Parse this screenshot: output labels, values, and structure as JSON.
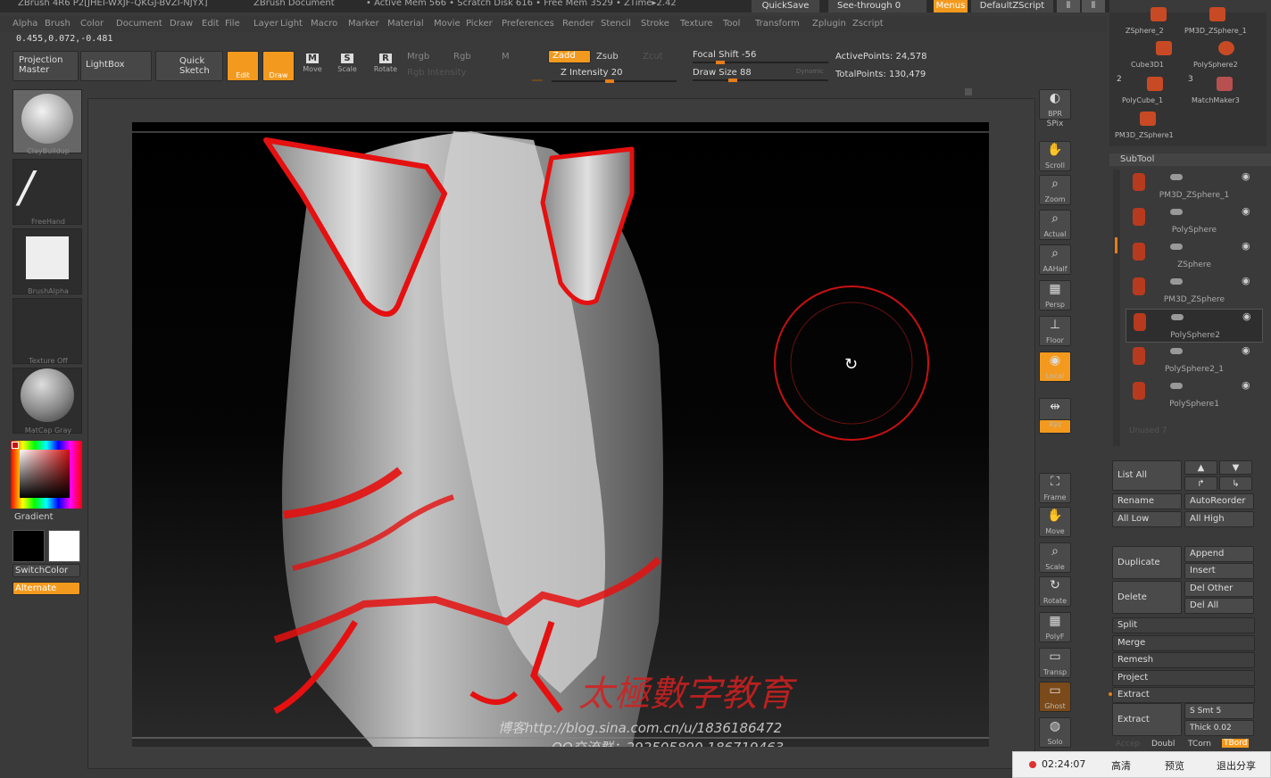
{
  "title": {
    "app": "ZBrush 4R6 P2[JHEI-WXJF-QKGJ-BVZI-NJYX]",
    "doc": "ZBrush Document",
    "stats": "• Active Mem 566 • Scratch Disk 616 • Free Mem 3529 • ZTime▸2.42",
    "quicksave": "QuickSave",
    "seethrough": "See-through   0",
    "menus": "Menus",
    "defaultzscript": "DefaultZScript"
  },
  "menu": [
    "Alpha",
    "Brush",
    "Color",
    "Document",
    "Draw",
    "Edit",
    "File",
    "Layer",
    "Light",
    "Macro",
    "Marker",
    "Material",
    "Movie",
    "Picker",
    "Preferences",
    "Render",
    "Stencil",
    "Stroke",
    "Texture",
    "Tool",
    "Transform",
    "Zplugin",
    "Zscript"
  ],
  "coords": "0.455,0.072,-0.481",
  "toolbar": {
    "projection_master": "Projection Master",
    "lightbox": "LightBox",
    "quick_sketch": "Quick Sketch",
    "edit": "Edit",
    "draw": "Draw",
    "move": "Move",
    "scale": "Scale",
    "rotate": "Rotate",
    "mrgb": "Mrgb",
    "rgb": "Rgb",
    "m": "M",
    "rgb_intensity": "Rgb Intensity",
    "zadd": "Zadd",
    "zsub": "Zsub",
    "zcut": "Zcut",
    "z_intensity": "Z Intensity 20",
    "focal_shift": "Focal Shift -56",
    "draw_size": "Draw Size 88",
    "dynamic": "Dynamic",
    "active_points": "ActivePoints: 24,578",
    "total_points": "TotalPoints: 130,479"
  },
  "left": {
    "brush": "ClayBuildup",
    "stroke": "FreeHand",
    "alpha": "BrushAlpha",
    "texture": "Texture Off",
    "material": "MatCap Gray",
    "gradient": "Gradient",
    "switchcolor": "SwitchColor",
    "alternate": "Alternate"
  },
  "shelf": [
    "BPR",
    "SPix",
    "Scroll",
    "Zoom",
    "Actual",
    "AAHalf",
    "Persp",
    "Floor",
    "Local",
    "L.Sym",
    "Xyz",
    "Frame",
    "Move",
    "Scale",
    "Rotate",
    "PolyF",
    "Transp",
    "Ghost",
    "Solo"
  ],
  "tools": {
    "items": [
      "ZSphere_2",
      "PM3D_ZSphere_1",
      "Cube3D1",
      "PolySphere2",
      "PolyCube_1",
      "MatchMaker3",
      "PM3D_ZSphere1"
    ],
    "count_a": "2",
    "count_b": "3"
  },
  "subtool": {
    "header": "SubTool",
    "rows": [
      "PM3D_ZSphere_1",
      "PolySphere",
      "ZSphere",
      "PM3D_ZSphere",
      "PolySphere2",
      "PolySphere2_1",
      "PolySphere1"
    ],
    "unused": "Unused 7",
    "list_all": "List All",
    "rename": "Rename",
    "autoreorder": "AutoReorder",
    "all_low": "All Low",
    "all_high": "All High",
    "duplicate": "Duplicate",
    "append": "Append",
    "insert": "Insert",
    "delete": "Delete",
    "del_other": "Del Other",
    "del_all": "Del All",
    "split": "Split",
    "merge": "Merge",
    "remesh": "Remesh",
    "project": "Project",
    "extract_header": "Extract",
    "extract": "Extract",
    "s_smt": "S Smt 5",
    "thick": "Thick 0.02",
    "accep": "Accep",
    "double": "Doubl",
    "tcorn": "TCorn",
    "tbord": "TBord"
  },
  "watermark": {
    "cn": "太極數字教育",
    "blog": "博客http://blog.sina.com.cn/u/1836186472",
    "qq": "QQ交流群：292505890  186719463"
  },
  "stream": {
    "time": "02:24:07",
    "hd": "高清",
    "preview": "预览",
    "exit": "退出分享"
  },
  "colors": {
    "accent": "#f39a1e",
    "brush": "#d01010"
  }
}
